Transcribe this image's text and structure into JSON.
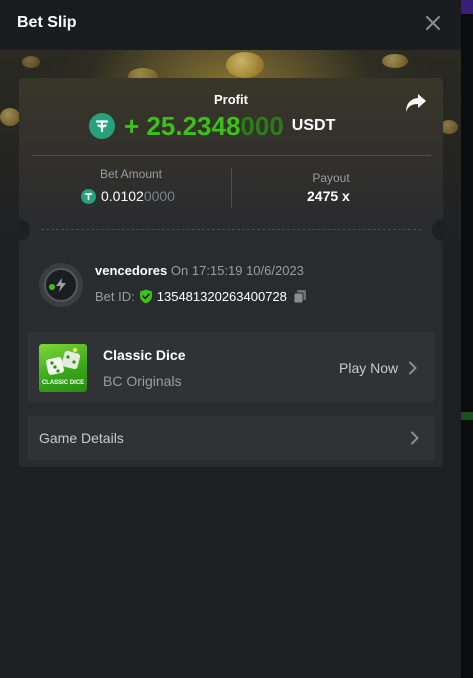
{
  "header": {
    "title": "Bet Slip",
    "close_icon": "close-icon"
  },
  "profit": {
    "label": "Profit",
    "sign": "+",
    "value_bright": "25.2348",
    "value_dim": "000",
    "currency": "USDT",
    "currency_icon": "tether-icon",
    "share_icon": "share-icon",
    "color_positive": "#3bc117"
  },
  "stats": {
    "bet_amount_label": "Bet Amount",
    "bet_amount_bright": "0.0102",
    "bet_amount_dim": "0000",
    "payout_label": "Payout",
    "payout_value": "2475 x"
  },
  "bet": {
    "username": "vencedores",
    "on_label": "On",
    "datetime": "17:15:19 10/6/2023",
    "bet_id_label": "Bet ID:",
    "bet_id": "135481320263400728",
    "verified_icon": "shield-check-icon",
    "copy_icon": "copy-icon"
  },
  "game": {
    "name": "Classic Dice",
    "provider": "BC Originals",
    "thumb_text": "CLASSIC DICE",
    "play_label": "Play Now"
  },
  "details": {
    "label": "Game Details"
  }
}
